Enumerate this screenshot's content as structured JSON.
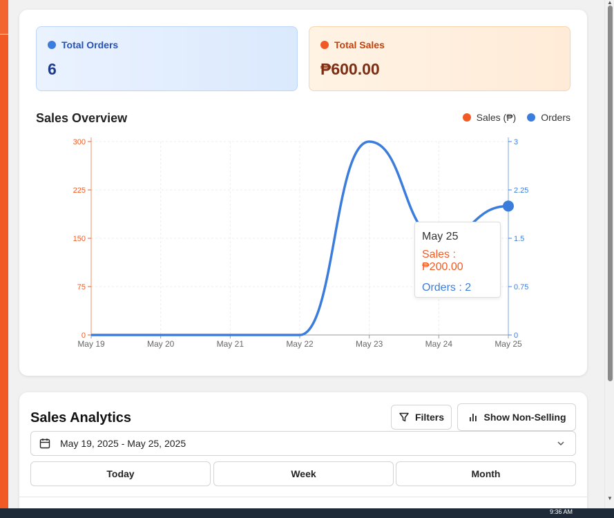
{
  "summary": {
    "orders": {
      "label": "Total Orders",
      "value": "6",
      "color": "#3b7ddd"
    },
    "sales": {
      "label": "Total Sales",
      "value": "₱600.00",
      "color": "#f15a24"
    }
  },
  "chart": {
    "title": "Sales Overview",
    "legend": [
      {
        "name": "Sales (₱)",
        "color": "#f15a24"
      },
      {
        "name": "Orders",
        "color": "#3b7ddd"
      }
    ],
    "tooltip": {
      "date": "May 25",
      "sales": "Sales : ₱200.00",
      "orders": "Orders : 2"
    }
  },
  "chart_data": {
    "type": "line",
    "title": "Sales Overview",
    "x": [
      "May 19",
      "May 20",
      "May 21",
      "May 22",
      "May 23",
      "May 24",
      "May 25"
    ],
    "series": [
      {
        "name": "Sales (₱)",
        "axis": "left",
        "values": [
          0,
          0,
          0,
          0,
          300,
          150,
          200
        ]
      },
      {
        "name": "Orders",
        "axis": "right",
        "values": [
          0,
          0,
          0,
          0,
          3,
          1.5,
          2
        ]
      }
    ],
    "ylim_left": [
      0,
      300
    ],
    "yticks_left": [
      "0",
      "75",
      "150",
      "225",
      "300"
    ],
    "ylim_right": [
      0,
      3
    ],
    "yticks_right": [
      "0",
      "0.75",
      "1.5",
      "2.25",
      "3"
    ],
    "grid": true,
    "legend_position": "top-right",
    "highlighted_point": "May 25"
  },
  "analytics": {
    "title": "Sales Analytics",
    "filters_label": "Filters",
    "nonselling_label": "Show Non-Selling",
    "date_range": "May 19, 2025 - May 25, 2025",
    "periods": [
      "Today",
      "Week",
      "Month"
    ]
  },
  "taskbar": {
    "time": "9:36 AM"
  }
}
